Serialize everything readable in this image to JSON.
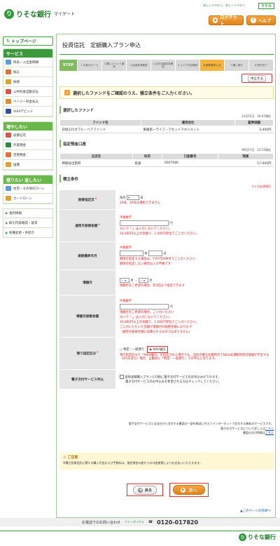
{
  "header": {
    "bank_name": "りそな銀行",
    "site_name": "マイゲート",
    "tagline": "…新しいりそなへ、新しいリそなヘ",
    "brand_box": "りそな",
    "logout_label": "ログアウト",
    "help_label": "ヘルプ"
  },
  "sidebar": {
    "top_page": "トップページ",
    "service_head": "サービス",
    "service_items": [
      "残高・入出金明細",
      "振込",
      "振替",
      "公共料金自動支払",
      "ペイジー料金払込",
      "VISAデビット"
    ],
    "increase_head": "増やしたい",
    "increase_items": [
      "投資信託",
      "外貨預金",
      "定期預金",
      "国債"
    ],
    "borrow_head": "借りたい 返したい",
    "borrow_items": [
      "住宅・その他のローン",
      "カードローン"
    ],
    "links": [
      "金利情報",
      "取引内容確認・取消",
      "各種変更・手続き"
    ]
  },
  "main": {
    "title": "投資信託　定額購入プラン申込",
    "step_label": "STEP",
    "steps": [
      "1.お取引カード",
      "2.購入ファンド選択",
      "3.目論見書確認",
      "4.交付目論見書確認",
      "5.リスク内容確認",
      "6.契約条件入力",
      "7.購入実行",
      "8.受付完了"
    ],
    "stop_button": "中止する",
    "notice": "選択したファンドをご確認のうえ、積立条件をご入力ください。",
    "fund_section": "選択したファンド",
    "fund_timestamp": "11月15日　16:47現在",
    "fund_headers": [
      "ファンド名",
      "運用会社",
      "基準価額"
    ],
    "fund_row": [
      "日経225ダブル・ベアファンド",
      "東銀第一ライフ・アセットマネジメント",
      "3,400円"
    ],
    "account_section": "指定預金口座",
    "account_timestamp": "09月17日　12:15現在",
    "account_headers": [
      "支店名",
      "科目",
      "口座番号",
      "残高"
    ],
    "account_row": [
      "押部谷出張所",
      "普通",
      "0007080",
      "17,000円"
    ],
    "plan_section": "積立条件",
    "required_note": "＊入力必須項目",
    "form": {
      "date_label": "振替指定日",
      "date_prefix": "毎月",
      "date_suffix": "日",
      "date_note": "29日、30日は選択できません",
      "amount_label": "通常月振替金額",
      "halfwidth": "半角数字",
      "yen": "円",
      "amount_note1": "カンマ「,」は入力しないでください。",
      "amount_note2": "10,000円以上の金額で、1,000円単位でご入力ください。",
      "enddate_label": "振替最終年月",
      "year": "年",
      "month": "月",
      "enddate_note1": "期限を指定する場合は、YYYY年MM月でご入力ください",
      "enddate_note2": "期限を指定しない場合は入力不要です",
      "bonus_month_label": "増額月",
      "select_dash": "－",
      "bonus_month_note": "増額月をご希望の場合、年2回まで指定できます",
      "bonus_amount_label": "増額月振替金額",
      "bonus_amount_note1": "増額月をご希望の場合、ご入力ください",
      "bonus_amount_note2": "カンマ「,」は入力しないでください。",
      "bonus_amount_note3": "10,000円以上の金額で、1,000円単位でご入力ください。",
      "bonus_amount_note4": "ご入力いただいた金額が増額月の振替金額になります",
      "bonus_amount_note5": "（通常月振替金額に加算されるものではありません）",
      "custody_label": "預り指定区分",
      "custody_opt1": "特定・一般預り",
      "custody_opt2": "NISA優先",
      "custody_note": "預り指定区分で「NISA優先」を指定された場合でも、当社の積立投資時点でNISA非課税利用可能額が不足する（0円を含む）場合、自動的に「特定・一般預り」での申込となります。",
      "edoc_label": "電子交付サービス申込",
      "edoc_check": "定時定額購入プランと同時に電子交付サービスのお申込みができます。",
      "edoc_note": "電子交付サービスのお申込みを希望される方はチェックしてください。"
    },
    "footnote1": "電子交付サービスとは当社から交付する書面の一部を郵送に代えてインターネットで交付する無料のサービスです。",
    "footnote2": "電子交付サービスについて詳しくは",
    "footnote3": "書面の交付時期は",
    "here": "こちら",
    "caution_head": "ご注意",
    "caution_body": "※積立投資信託に関する購入代金および手数料は、指定預金口座からの口座振替によりお支払いいただきます。",
    "back_button": "戻る",
    "next_button": "次へ",
    "page_top": "このページの先頭へ"
  },
  "footer": {
    "inquiry": "お電話でのお問い合わせ",
    "freedial": "フリーダイヤル",
    "phone": "0120-017820",
    "bank_name": "りそな銀行"
  },
  "colors": {
    "brand_green": "#2f9a3b",
    "accent_orange": "#f4b43c",
    "alert_red": "#e02020"
  }
}
